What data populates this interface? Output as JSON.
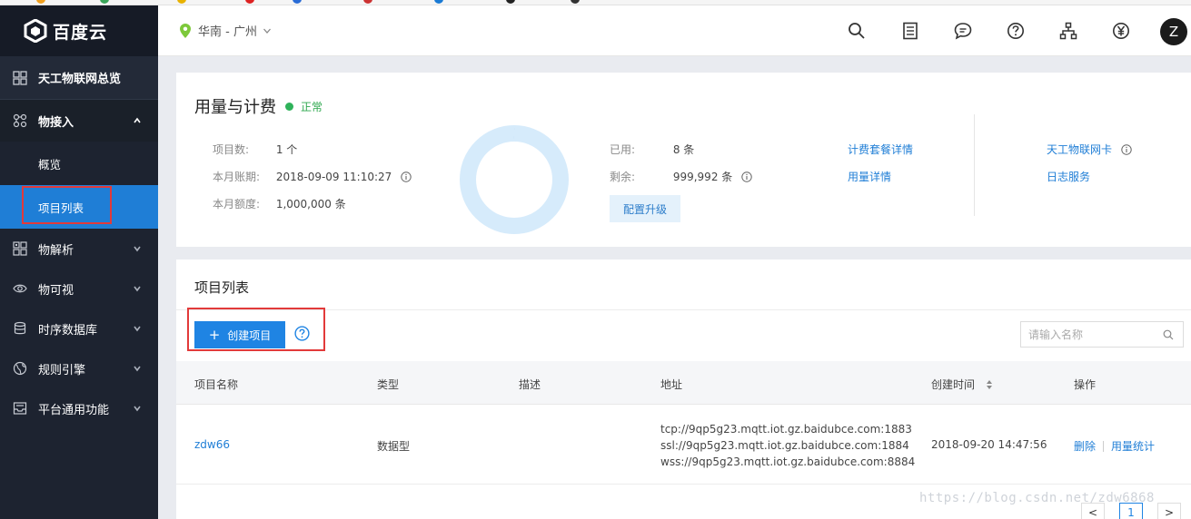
{
  "sidebar": {
    "logo": "百度云",
    "overview": "天工物联网总览",
    "groups": [
      {
        "label": "物接入"
      },
      {
        "label": "物解析"
      },
      {
        "label": "物可视"
      },
      {
        "label": "时序数据库"
      },
      {
        "label": "规则引擎"
      },
      {
        "label": "平台通用功能"
      }
    ],
    "sub_items": [
      {
        "label": "概览"
      },
      {
        "label": "项目列表"
      }
    ]
  },
  "topbar": {
    "region": "华南 - 广州",
    "avatar": "Z",
    "icons": [
      "search-icon",
      "document-list-icon",
      "message-icon",
      "help-icon",
      "sitemap-icon",
      "yen-icon"
    ]
  },
  "usage": {
    "title": "用量与计费",
    "status": "正常",
    "project_count": {
      "label": "项目数:",
      "value": "1 个"
    },
    "billing_period": {
      "label": "本月账期:",
      "value": "2018-09-09 11:10:27"
    },
    "monthly_quota": {
      "label": "本月额度:",
      "value": "1,000,000 条"
    },
    "used": {
      "label": "已用:",
      "value": "8 条"
    },
    "remaining": {
      "label": "剩余:",
      "value": "999,992 条"
    },
    "used_fraction": 8e-06,
    "upgrade": "配置升级",
    "links": {
      "package_detail": "计费套餐详情",
      "usage_detail": "用量详情",
      "iot_card": "天工物联网卡",
      "log_service": "日志服务"
    }
  },
  "project_list": {
    "title": "项目列表",
    "create": "创建项目",
    "search_placeholder": "请输入名称",
    "columns": {
      "name": "项目名称",
      "type": "类型",
      "desc": "描述",
      "address": "地址",
      "created": "创建时间",
      "ops": "操作"
    },
    "rows": [
      {
        "name": "zdw66",
        "type": "数据型",
        "desc": "",
        "addresses": [
          "tcp://9qp5g23.mqtt.iot.gz.baidubce.com:1883",
          "ssl://9qp5g23.mqtt.iot.gz.baidubce.com:1884",
          "wss://9qp5g23.mqtt.iot.gz.baidubce.com:8884"
        ],
        "created": "2018-09-20 14:47:56",
        "op_delete": "删除",
        "op_stats": "用量统计"
      }
    ],
    "pagination": {
      "prev": "<",
      "current": "1",
      "next": ">"
    }
  },
  "colors": {
    "sidebar_bg": "#1d2330",
    "accent": "#1f84e3",
    "status_green": "#2fb25a",
    "highlight_red": "#e23a3a"
  },
  "watermark": "https://blog.csdn.net/zdw6868"
}
